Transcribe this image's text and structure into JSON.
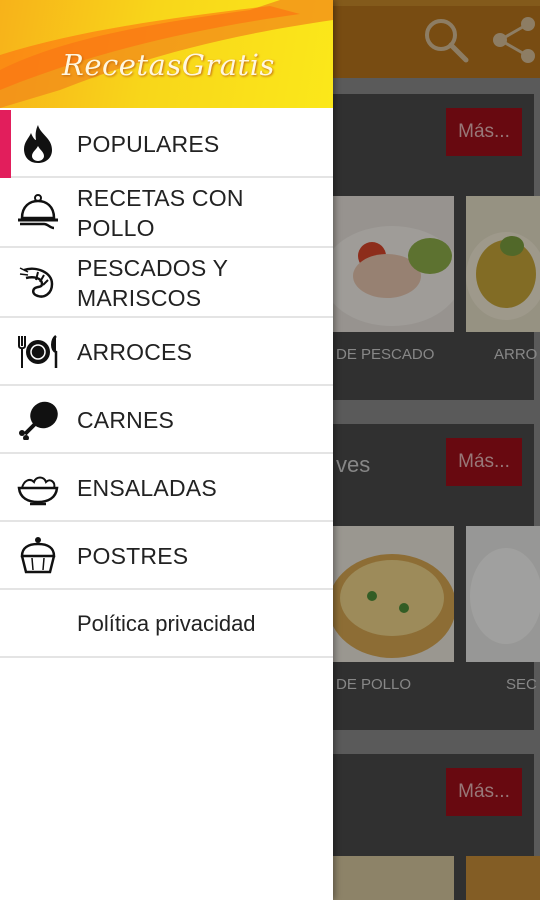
{
  "drawer": {
    "brand": "RecetasGratis",
    "items": [
      {
        "label": "POPULARES",
        "icon": "flame-icon"
      },
      {
        "label": "RECETAS CON POLLO",
        "icon": "serving-dish-icon"
      },
      {
        "label": "PESCADOS Y MARISCOS",
        "icon": "shrimp-icon"
      },
      {
        "label": "ARROCES",
        "icon": "plate-cutlery-icon"
      },
      {
        "label": "CARNES",
        "icon": "drumstick-icon"
      },
      {
        "label": "ENSALADAS",
        "icon": "salad-icon"
      },
      {
        "label": "POSTRES",
        "icon": "cake-icon"
      }
    ],
    "privacy": "Política privacidad",
    "active_color": "#e21e5c"
  },
  "background": {
    "cards": [
      {
        "title": "",
        "more": "Más...",
        "labels": [
          "DE PESCADO",
          "ARRO"
        ]
      },
      {
        "title": "ves",
        "more": "Más...",
        "labels": [
          "DE POLLO",
          "SEC"
        ]
      },
      {
        "title": "",
        "more": "Más...",
        "labels": []
      }
    ]
  }
}
